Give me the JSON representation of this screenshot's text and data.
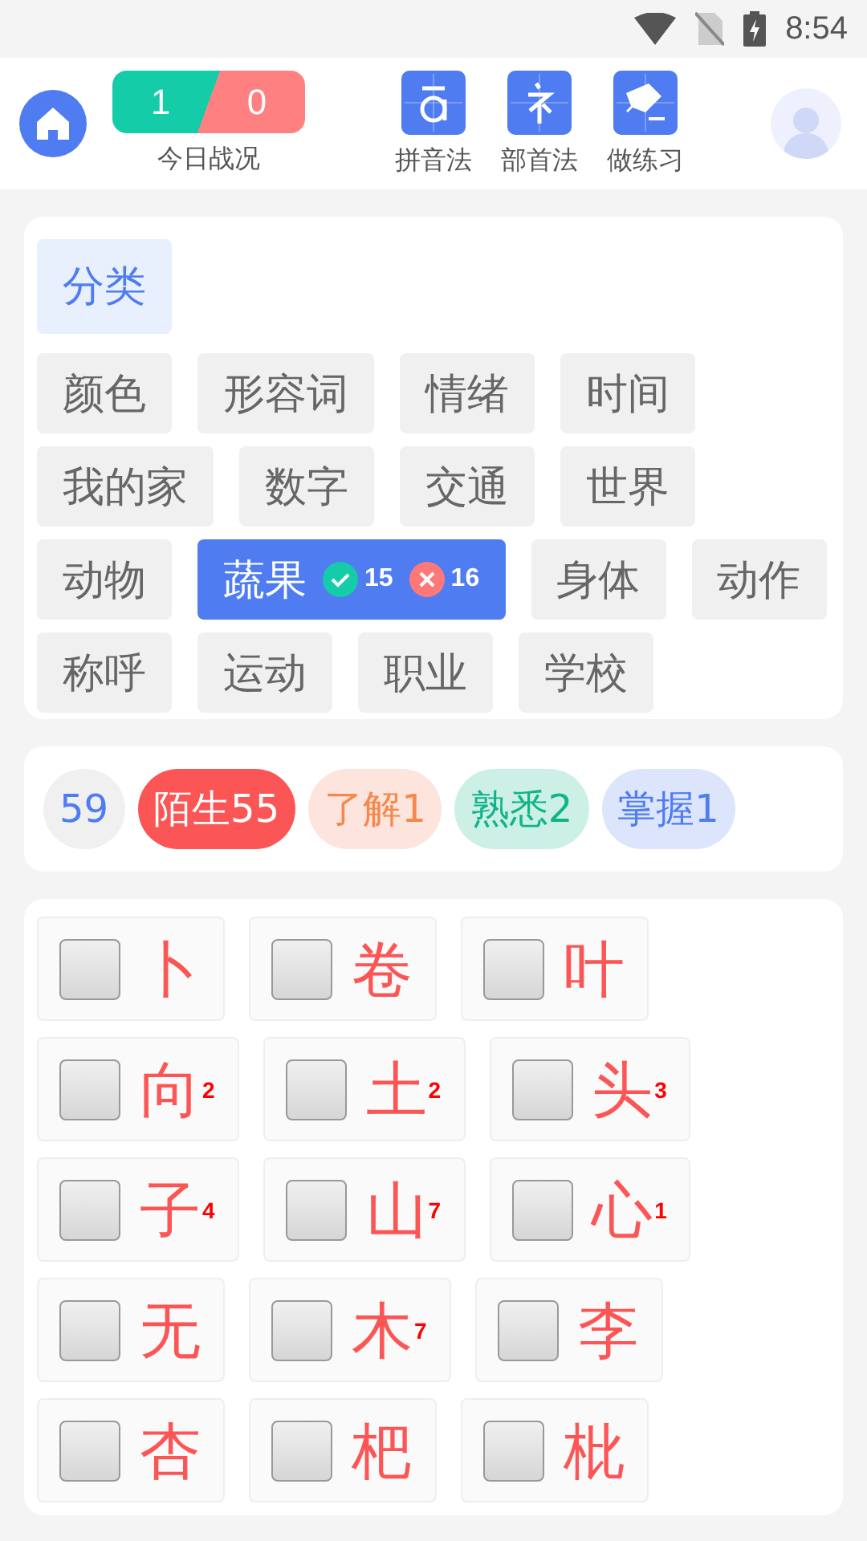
{
  "status_bar": {
    "time": "8:54"
  },
  "header": {
    "score": {
      "correct": "1",
      "wrong": "0",
      "label": "今日战况"
    },
    "tools": [
      {
        "kind": "pinyin",
        "label": "拼音法"
      },
      {
        "kind": "radical",
        "label": "部首法"
      },
      {
        "kind": "practice",
        "label": "做练习"
      }
    ]
  },
  "categories": {
    "title": "分类",
    "items": [
      {
        "label": "颜色",
        "selected": false
      },
      {
        "label": "形容词",
        "selected": false
      },
      {
        "label": "情绪",
        "selected": false
      },
      {
        "label": "时间",
        "selected": false
      },
      {
        "label": "我的家",
        "selected": false
      },
      {
        "label": "数字",
        "selected": false
      },
      {
        "label": "交通",
        "selected": false
      },
      {
        "label": "世界",
        "selected": false
      },
      {
        "label": "动物",
        "selected": false
      },
      {
        "label": "蔬果",
        "selected": true,
        "correct": "15",
        "wrong": "16"
      },
      {
        "label": "身体",
        "selected": false
      },
      {
        "label": "动作",
        "selected": false
      },
      {
        "label": "称呼",
        "selected": false
      },
      {
        "label": "运动",
        "selected": false
      },
      {
        "label": "职业",
        "selected": false
      },
      {
        "label": "学校",
        "selected": false
      }
    ]
  },
  "filters": [
    {
      "kind": "total",
      "label": "59"
    },
    {
      "kind": "stranger",
      "label": "陌生55"
    },
    {
      "kind": "known",
      "label": "了解1"
    },
    {
      "kind": "familiar",
      "label": "熟悉2"
    },
    {
      "kind": "mastered",
      "label": "掌握1"
    }
  ],
  "words": [
    {
      "char": "卜",
      "checked": false
    },
    {
      "char": "卷",
      "checked": false
    },
    {
      "char": "叶",
      "checked": false
    },
    {
      "char": "向",
      "count": "2",
      "checked": false
    },
    {
      "char": "土",
      "count": "2",
      "checked": false
    },
    {
      "char": "头",
      "count": "3",
      "checked": false
    },
    {
      "char": "子",
      "count": "4",
      "checked": false
    },
    {
      "char": "山",
      "count": "7",
      "checked": false
    },
    {
      "char": "心",
      "count": "1",
      "checked": false
    },
    {
      "char": "无",
      "checked": false
    },
    {
      "char": "木",
      "count": "7",
      "checked": false
    },
    {
      "char": "李",
      "checked": false
    },
    {
      "char": "杏",
      "checked": false
    },
    {
      "char": "杷",
      "checked": false
    },
    {
      "char": "枇",
      "checked": false
    }
  ]
}
